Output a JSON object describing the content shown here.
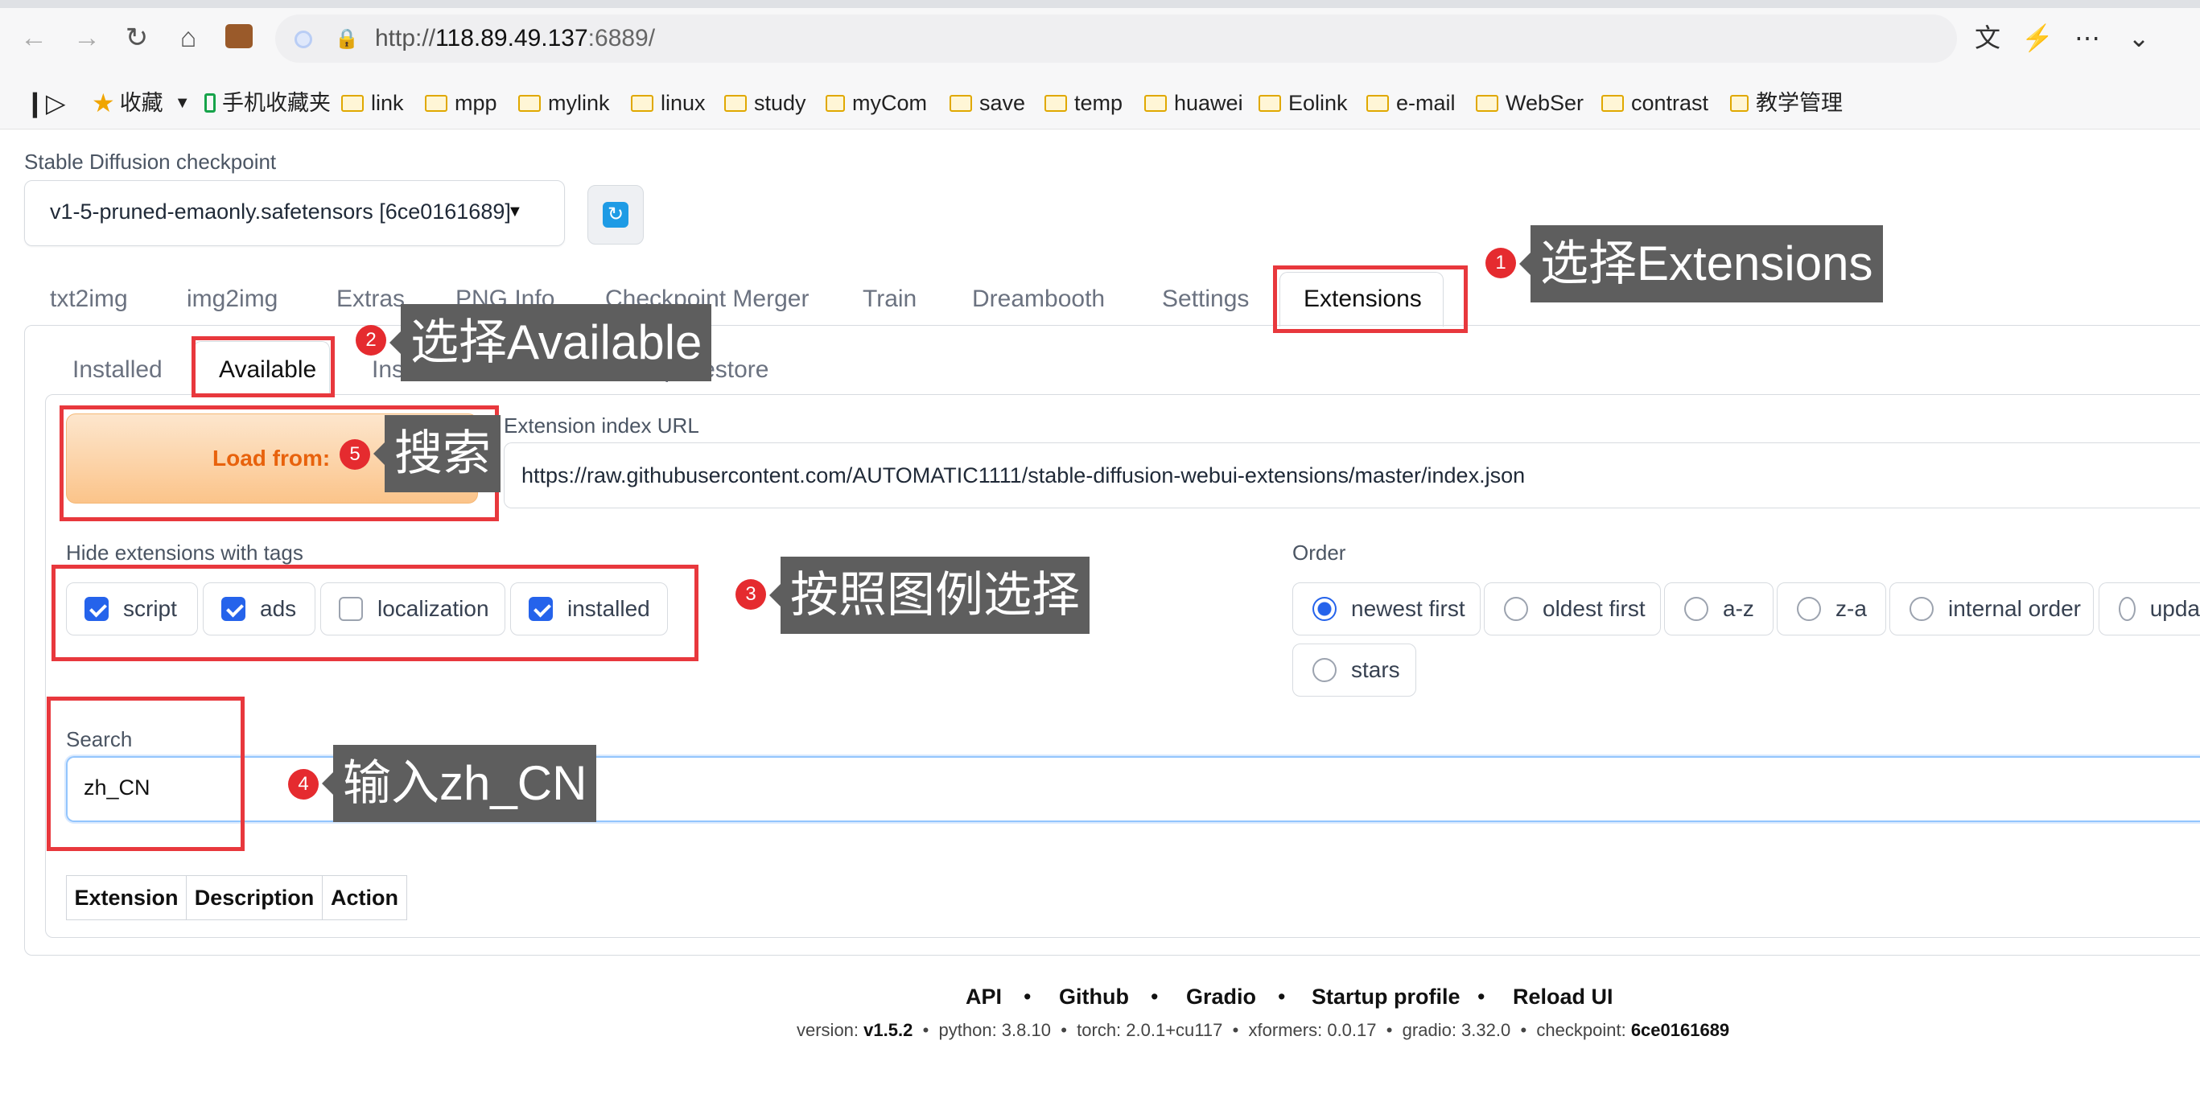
{
  "browser": {
    "url_scheme": "http://",
    "url_host": "118.89.49.137",
    "url_port_path": ":6889/",
    "bookmarks": [
      {
        "label": "收藏",
        "icon": "star-icon"
      },
      {
        "label": "手机收藏夹",
        "icon": "phone-icon"
      },
      {
        "label": "link"
      },
      {
        "label": "mpp"
      },
      {
        "label": "mylink"
      },
      {
        "label": "linux"
      },
      {
        "label": "study"
      },
      {
        "label": "myCom"
      },
      {
        "label": "save"
      },
      {
        "label": "temp"
      },
      {
        "label": "huawei"
      },
      {
        "label": "Eolink"
      },
      {
        "label": "e-mail"
      },
      {
        "label": "WebSer"
      },
      {
        "label": "contrast"
      },
      {
        "label": "教学管理"
      }
    ]
  },
  "checkpoint": {
    "label": "Stable Diffusion checkpoint",
    "value": "v1-5-pruned-emaonly.safetensors [6ce0161689]"
  },
  "tabs": [
    "txt2img",
    "img2img",
    "Extras",
    "PNG Info",
    "Checkpoint Merger",
    "Train",
    "Dreambooth",
    "Settings",
    "Extensions"
  ],
  "subtabs": [
    "Installed",
    "Available",
    "Install from URL",
    "Backup/Restore"
  ],
  "available": {
    "load_button": "Load from:",
    "index_url_label": "Extension index URL",
    "index_url": "https://raw.githubusercontent.com/AUTOMATIC1111/stable-diffusion-webui-extensions/master/index.json",
    "hide_label": "Hide extensions with tags",
    "hide_tags": [
      {
        "label": "script",
        "checked": true
      },
      {
        "label": "ads",
        "checked": true
      },
      {
        "label": "localization",
        "checked": false
      },
      {
        "label": "installed",
        "checked": true
      }
    ],
    "order_label": "Order",
    "order_options": [
      {
        "label": "newest first",
        "selected": true
      },
      {
        "label": "oldest first",
        "selected": false
      },
      {
        "label": "a-z",
        "selected": false
      },
      {
        "label": "z-a",
        "selected": false
      },
      {
        "label": "internal order",
        "selected": false
      },
      {
        "label": "upda",
        "selected": false
      },
      {
        "label": "stars",
        "selected": false
      }
    ],
    "search_label": "Search",
    "search_value": "zh_CN",
    "table_headers": [
      "Extension",
      "Description",
      "Action"
    ]
  },
  "annotations": [
    {
      "num": "1",
      "text": "选择Extensions"
    },
    {
      "num": "2",
      "text": "选择Available"
    },
    {
      "num": "3",
      "text": "按照图例选择"
    },
    {
      "num": "4",
      "text": "输入zh_CN"
    },
    {
      "num": "5",
      "text": "搜索"
    }
  ],
  "footer": {
    "links": [
      "API",
      "Github",
      "Gradio",
      "Startup profile",
      "Reload UI"
    ],
    "sep": "•",
    "version_label": "version:",
    "version": "v1.5.2",
    "python": "python: 3.8.10",
    "torch": "torch: 2.0.1+cu117",
    "xformers": "xformers: 0.0.17",
    "gradio": "gradio: 3.32.0",
    "checkpoint_label": "checkpoint:",
    "checkpoint": "6ce0161689"
  },
  "colors": {
    "accent": "#2563eb",
    "annotation_red": "#e8383d",
    "callout_bg": "#5e5e5e",
    "load_orange": "#e8620c"
  }
}
